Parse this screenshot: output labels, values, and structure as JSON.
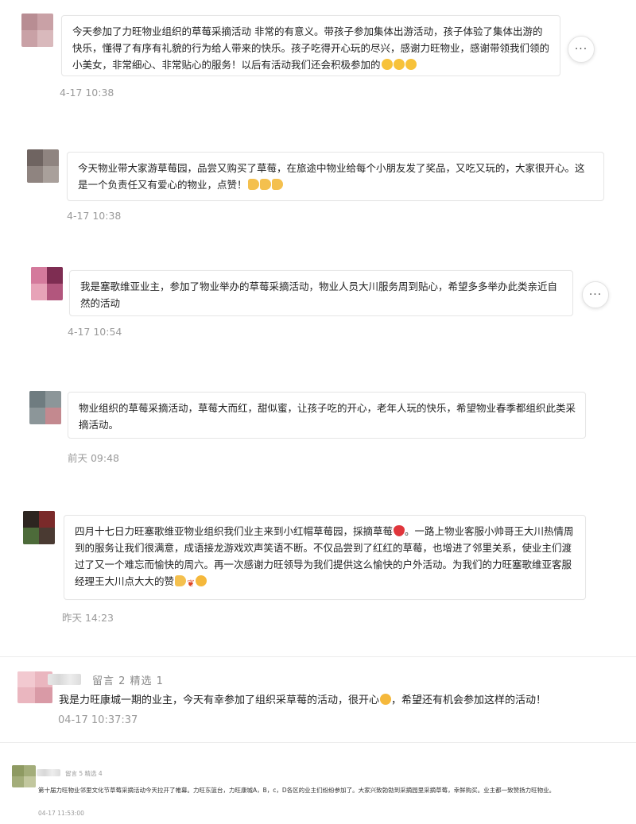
{
  "comments": [
    {
      "text": "今天参加了力旺物业组织的草莓采摘活动 非常的有意义。带孩子参加集体出游活动，孩子体验了集体出游的快乐，懂得了有序有礼貌的行为给人带来的快乐。孩子吃得开心玩的尽兴，感谢力旺物业，感谢带领我们领的小美女，非常细心、非常贴心的服务！以后有活动我们还会积极参加的",
      "emojis": [
        "star-emoji",
        "star-emoji",
        "star-emoji"
      ],
      "time": "4-17 10:38",
      "more_label": "···"
    },
    {
      "text": "今天物业带大家游草莓园，品尝又购买了草莓，在旅途中物业给每个小朋友发了奖品，又吃又玩的，大家很开心。这是一个负责任又有爱心的物业，点赞！",
      "emojis": [
        "thumbs-up-emoji",
        "thumbs-up-emoji",
        "thumbs-up-emoji"
      ],
      "time": "4-17 10:38"
    },
    {
      "text": "我是塞歌维亚业主，参加了物业举办的草莓采摘活动，物业人员大川服务周到贴心，希望多多举办此类亲近自然的活动",
      "time": "4-17 10:54",
      "more_label": "···"
    },
    {
      "text": "物业组织的草莓采摘活动，草莓大而红，甜似蜜，让孩子吃的开心，老年人玩的快乐，希望物业春季都组织此类采摘活动。",
      "time": "前天 09:48"
    },
    {
      "text_a": "四月十七日力旺塞歌维亚物业组织我们业主来到小红帽草莓园，採摘草莓",
      "text_b": "。一路上物业客服小帅哥王大川热情周到的服务让我们很满意，成语接龙游戏欢声笑语不断。不仅品尝到了红红的草莓，也增进了邻里关系，使业主们渡过了又一个难忘而愉快的周六。再一次感谢力旺领导为我们提供这么愉快的户外活动。为我们的力旺塞歌维亚客服经理王大川点大大的赞",
      "time": "昨天 14:23"
    }
  ],
  "post_a": {
    "meta": "留言 2   精选 1",
    "text_a": "我是力旺康城一期的业主，今天有幸参加了组织采草莓的活动，很开心",
    "text_b": "，希望还有机会参加这样的活动！",
    "time": "04-17 10:37:37"
  },
  "post_b": {
    "meta": "留言 5   精选 4",
    "text": "第十届力旺物业邻里文化节草莓采摘活动今天拉开了帷幕。力旺东篮台，力旺康城A，B，c，D各区的业主们纷纷参加了。大家兴致勃勃到采摘园里采摘草莓，幸鲜购买。业主都一致赞扬力旺物业。",
    "time": "04-17 11:53:00"
  }
}
